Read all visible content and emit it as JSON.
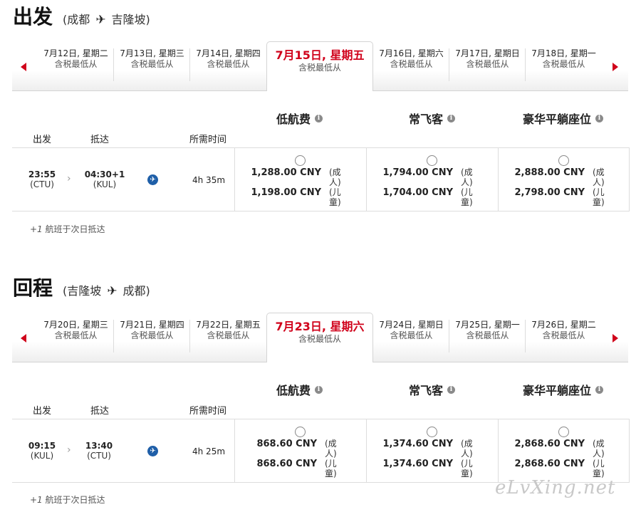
{
  "outbound": {
    "title": "出发",
    "origin": "成都",
    "destination": "吉隆坡",
    "dates": [
      {
        "label": "7月12日, 星期二",
        "sub": "含税最低从"
      },
      {
        "label": "7月13日, 星期三",
        "sub": "含税最低从"
      },
      {
        "label": "7月14日, 星期四",
        "sub": "含税最低从"
      },
      {
        "label": "7月15日, 星期五",
        "sub": "含税最低从"
      },
      {
        "label": "7月16日, 星期六",
        "sub": "含税最低从"
      },
      {
        "label": "7月17日, 星期日",
        "sub": "含税最低从"
      },
      {
        "label": "7月18日, 星期一",
        "sub": "含税最低从"
      }
    ],
    "selected_index": 3,
    "fare_classes": [
      "低航费",
      "常飞客",
      "豪华平躺座位"
    ],
    "col_depart": "出发",
    "col_arrive": "抵达",
    "col_duration": "所需时间",
    "flight": {
      "depart_time": "23:55",
      "depart_code": "(CTU)",
      "arrive_time": "04:30+1",
      "arrive_code": "(KUL)",
      "duration": "4h 35m",
      "fares": [
        {
          "adult": "1,288.00 CNY",
          "child": "1,198.00 CNY"
        },
        {
          "adult": "1,794.00 CNY",
          "child": "1,704.00 CNY"
        },
        {
          "adult": "2,888.00 CNY",
          "child": "2,798.00 CNY"
        }
      ]
    },
    "adult_label": "(成人)",
    "child_label": "(儿童)",
    "footnote_mark": "+1",
    "footnote_text": "航班于次日抵达"
  },
  "inbound": {
    "title": "回程",
    "origin": "吉隆坡",
    "destination": "成都",
    "dates": [
      {
        "label": "7月20日, 星期三",
        "sub": "含税最低从"
      },
      {
        "label": "7月21日, 星期四",
        "sub": "含税最低从"
      },
      {
        "label": "7月22日, 星期五",
        "sub": "含税最低从"
      },
      {
        "label": "7月23日, 星期六",
        "sub": "含税最低从"
      },
      {
        "label": "7月24日, 星期日",
        "sub": "含税最低从"
      },
      {
        "label": "7月25日, 星期一",
        "sub": "含税最低从"
      },
      {
        "label": "7月26日, 星期二",
        "sub": "含税最低从"
      }
    ],
    "selected_index": 3,
    "fare_classes": [
      "低航费",
      "常飞客",
      "豪华平躺座位"
    ],
    "col_depart": "出发",
    "col_arrive": "抵达",
    "col_duration": "所需时间",
    "flight": {
      "depart_time": "09:15",
      "depart_code": "(KUL)",
      "arrive_time": "13:40",
      "arrive_code": "(CTU)",
      "duration": "4h 25m",
      "fares": [
        {
          "adult": "868.60 CNY",
          "child": "868.60 CNY"
        },
        {
          "adult": "1,374.60 CNY",
          "child": "1,374.60 CNY"
        },
        {
          "adult": "2,868.60 CNY",
          "child": "2,868.60 CNY"
        }
      ]
    },
    "adult_label": "(成人)",
    "child_label": "(儿童)",
    "footnote_mark": "+1",
    "footnote_text": "航班于次日抵达"
  },
  "icons": {
    "plane": "airplane-icon",
    "info": "info-icon",
    "flight": "flight-details-icon",
    "nav_prev": "prev-arrow-icon",
    "nav_next": "next-arrow-icon"
  },
  "colors": {
    "accent": "#d0021b",
    "flight_icon": "#1f5fa8"
  },
  "watermark": "eLvXing.net"
}
